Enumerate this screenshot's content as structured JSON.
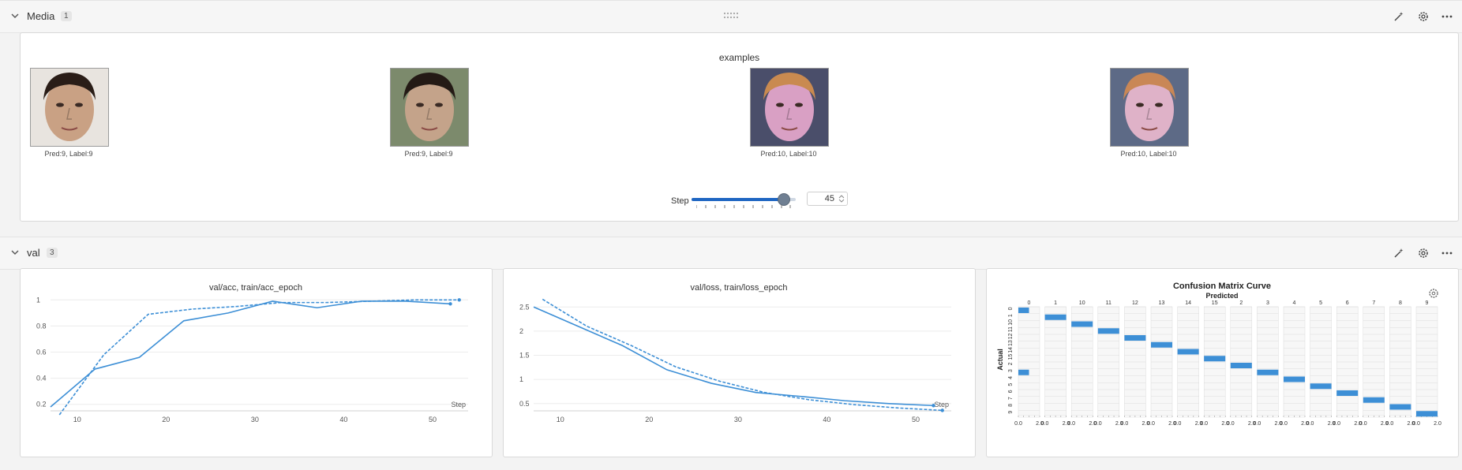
{
  "sections": {
    "media": {
      "title": "Media",
      "count": "1"
    },
    "val": {
      "title": "val",
      "count": "3"
    }
  },
  "media_panel": {
    "title": "examples",
    "images": [
      {
        "caption": "Pred:9, Label:9",
        "skin": "#c9a184",
        "hair": "#2a1d17",
        "bg": "#e8e4df"
      },
      {
        "caption": "Pred:9, Label:9",
        "skin": "#c4a38a",
        "hair": "#241a15",
        "bg": "#7c8a6c"
      },
      {
        "caption": "Pred:10, Label:10",
        "skin": "#d9a0c4",
        "hair": "#c98a50",
        "bg": "#4a4e6a"
      },
      {
        "caption": "Pred:10, Label:10",
        "skin": "#dfb2c8",
        "hair": "#c98756",
        "bg": "#5d6a86"
      }
    ],
    "step": {
      "label": "Step",
      "value": "45",
      "fraction": 0.88
    }
  },
  "icons": [
    "chevron-down-icon",
    "drag-handle-icon",
    "magic-wand-icon",
    "gear-icon",
    "more-horizontal-icon"
  ],
  "colors": {
    "accent": "#1f66c2",
    "series": "#3d8fd6"
  },
  "chart_data": [
    {
      "type": "line",
      "title": "val/acc, train/acc_epoch",
      "xlabel": "Step",
      "xlim": [
        7,
        54
      ],
      "ylim": [
        0.15,
        1.02
      ],
      "xticks": [
        "10",
        "20",
        "30",
        "40",
        "50"
      ],
      "yticks": [
        "0.2",
        "0.4",
        "0.6",
        "0.8",
        "1"
      ],
      "series": [
        {
          "style": "solid",
          "x": [
            7,
            12,
            17,
            22,
            27,
            32,
            37,
            42,
            47,
            52
          ],
          "y": [
            0.18,
            0.47,
            0.56,
            0.84,
            0.9,
            0.99,
            0.94,
            0.99,
            0.99,
            0.97
          ]
        },
        {
          "style": "dashed",
          "x": [
            8,
            13,
            18,
            23,
            28,
            33,
            38,
            43,
            48,
            53
          ],
          "y": [
            0.12,
            0.58,
            0.89,
            0.93,
            0.95,
            0.98,
            0.98,
            0.99,
            1.0,
            1.0
          ]
        }
      ]
    },
    {
      "type": "line",
      "title": "val/loss, train/loss_epoch",
      "xlabel": "Step",
      "xlim": [
        7,
        54
      ],
      "ylim": [
        0.35,
        2.7
      ],
      "xticks": [
        "10",
        "20",
        "30",
        "40",
        "50"
      ],
      "yticks": [
        "0.5",
        "1",
        "1.5",
        "2",
        "2.5"
      ],
      "series": [
        {
          "style": "solid",
          "x": [
            7,
            12,
            17,
            22,
            27,
            32,
            37,
            42,
            47,
            52
          ],
          "y": [
            2.5,
            2.1,
            1.7,
            1.2,
            0.92,
            0.73,
            0.65,
            0.56,
            0.5,
            0.46
          ]
        },
        {
          "style": "dashed",
          "x": [
            8,
            13,
            18,
            23,
            28,
            33,
            38,
            43,
            48,
            53
          ],
          "y": [
            2.66,
            2.1,
            1.7,
            1.26,
            0.96,
            0.73,
            0.58,
            0.48,
            0.41,
            0.36
          ]
        }
      ]
    },
    {
      "type": "heatmap",
      "title": "Confusion Matrix Curve",
      "xlabel": "Predicted",
      "ylabel": "Actual",
      "columns": [
        "0",
        "1",
        "10",
        "11",
        "12",
        "13",
        "14",
        "15",
        "2",
        "3",
        "4",
        "5",
        "6",
        "7",
        "8",
        "9"
      ],
      "row_labels": [
        "0",
        "1",
        "10",
        "11",
        "12",
        "13",
        "14",
        "15",
        "2",
        "3",
        "4",
        "5",
        "6",
        "7",
        "8",
        "9"
      ],
      "bottom_ticks": [
        "0.0",
        "2.0"
      ],
      "values": [
        [
          0.5,
          0,
          0,
          0,
          0,
          0,
          0,
          0,
          0,
          0,
          0,
          0,
          0,
          0,
          0,
          0
        ],
        [
          0,
          1,
          0,
          0,
          0,
          0,
          0,
          0,
          0,
          0,
          0,
          0,
          0,
          0,
          0,
          0
        ],
        [
          0,
          0,
          1,
          0,
          0,
          0,
          0,
          0,
          0,
          0,
          0,
          0,
          0,
          0,
          0,
          0
        ],
        [
          0,
          0,
          0,
          1,
          0,
          0,
          0,
          0,
          0,
          0,
          0,
          0,
          0,
          0,
          0,
          0
        ],
        [
          0,
          0,
          0,
          0,
          1,
          0,
          0,
          0,
          0,
          0,
          0,
          0,
          0,
          0,
          0,
          0
        ],
        [
          0,
          0,
          0,
          0,
          0,
          1,
          0,
          0,
          0,
          0,
          0,
          0,
          0,
          0,
          0,
          0
        ],
        [
          0,
          0,
          0,
          0,
          0,
          0,
          1,
          0,
          0,
          0,
          0,
          0,
          0,
          0,
          0,
          0
        ],
        [
          0,
          0,
          0,
          0,
          0,
          0,
          0,
          1,
          0,
          0,
          0,
          0,
          0,
          0,
          0,
          0
        ],
        [
          0,
          0,
          0,
          0,
          0,
          0,
          0,
          0,
          1,
          0,
          0,
          0,
          0,
          0,
          0,
          0
        ],
        [
          0.5,
          0,
          0,
          0,
          0,
          0,
          0,
          0,
          0,
          1,
          0,
          0,
          0,
          0,
          0,
          0
        ],
        [
          0,
          0,
          0,
          0,
          0,
          0,
          0,
          0,
          0,
          0,
          1,
          0,
          0,
          0,
          0,
          0
        ],
        [
          0,
          0,
          0,
          0,
          0,
          0,
          0,
          0,
          0,
          0,
          0,
          1,
          0,
          0,
          0,
          0
        ],
        [
          0,
          0,
          0,
          0,
          0,
          0,
          0,
          0,
          0,
          0,
          0,
          0,
          1,
          0,
          0,
          0
        ],
        [
          0,
          0,
          0,
          0,
          0,
          0,
          0,
          0,
          0,
          0,
          0,
          0,
          0,
          1,
          0,
          0
        ],
        [
          0,
          0,
          0,
          0,
          0,
          0,
          0,
          0,
          0,
          0,
          0,
          0,
          0,
          0,
          1,
          0
        ],
        [
          0,
          0,
          0,
          0,
          0,
          0,
          0,
          0,
          0,
          0,
          0,
          0,
          0,
          0,
          0,
          1
        ]
      ]
    }
  ]
}
